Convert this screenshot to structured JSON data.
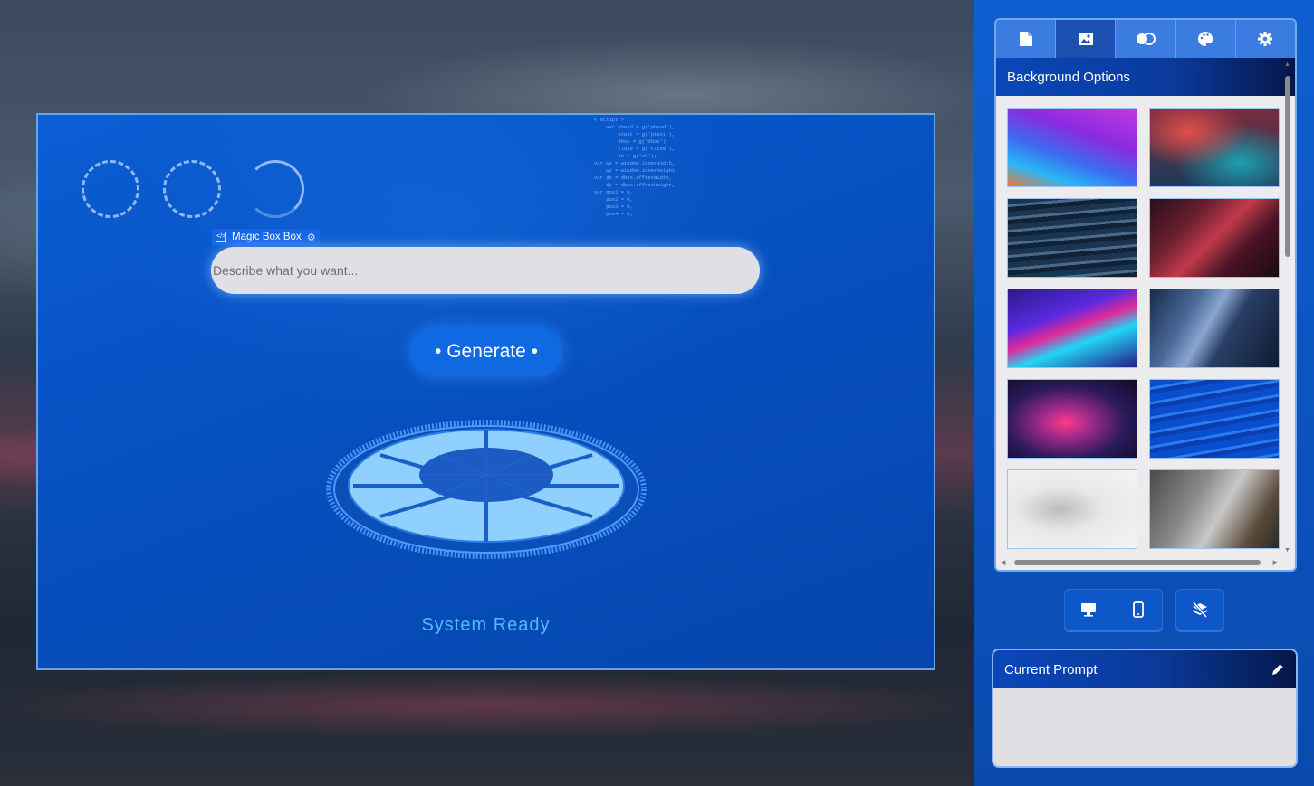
{
  "preview": {
    "code_lines": [
      "< script >",
      "    var phead = g('phead'),",
      "        ptext = g('ptext'),",
      "        dbox = g('dbox'),",
      "        close = g('close'),",
      "        ok = g('ok');",
      "var wx = window.innerWidth,",
      "    wy = window.innerHeight,",
      "var dx = dbox.offsetWidth,",
      "    dy = dbox.offsetHeight,",
      "var pos1 = 0,",
      "    pos2 = 0,",
      "    pos3 = 0,",
      "    pos4 = 0;"
    ],
    "tag_label": "Magic Box Box",
    "input_placeholder": "Describe what you want...",
    "generate_label": "• Generate •",
    "status_text": "System Ready",
    "accent": "#0f6ae2",
    "status_color": "#54b8ff"
  },
  "sidebar": {
    "tabs": [
      {
        "icon": "document-icon",
        "active": false
      },
      {
        "icon": "image-icon",
        "active": true
      },
      {
        "icon": "blend-icon",
        "active": false
      },
      {
        "icon": "palette-icon",
        "active": false
      },
      {
        "icon": "gear-icon",
        "active": false
      }
    ],
    "background_title": "Background Options",
    "thumbnails": [
      "abstract-purple-blue-wave",
      "red-teal-smoke",
      "ocean-waves",
      "red-geometric-cubes",
      "neon-diagonal-stripes",
      "blue-polygon-shards",
      "pink-glow-dark",
      "blue-water-surface",
      "laptop-desk-top-view",
      "laptop-hand-pointing"
    ],
    "device_buttons": [
      "desktop-icon",
      "mobile-icon"
    ],
    "layers_button": "layers-off-icon",
    "current_prompt_title": "Current Prompt",
    "current_prompt_text": "",
    "edit_icon": "pencil-icon"
  }
}
